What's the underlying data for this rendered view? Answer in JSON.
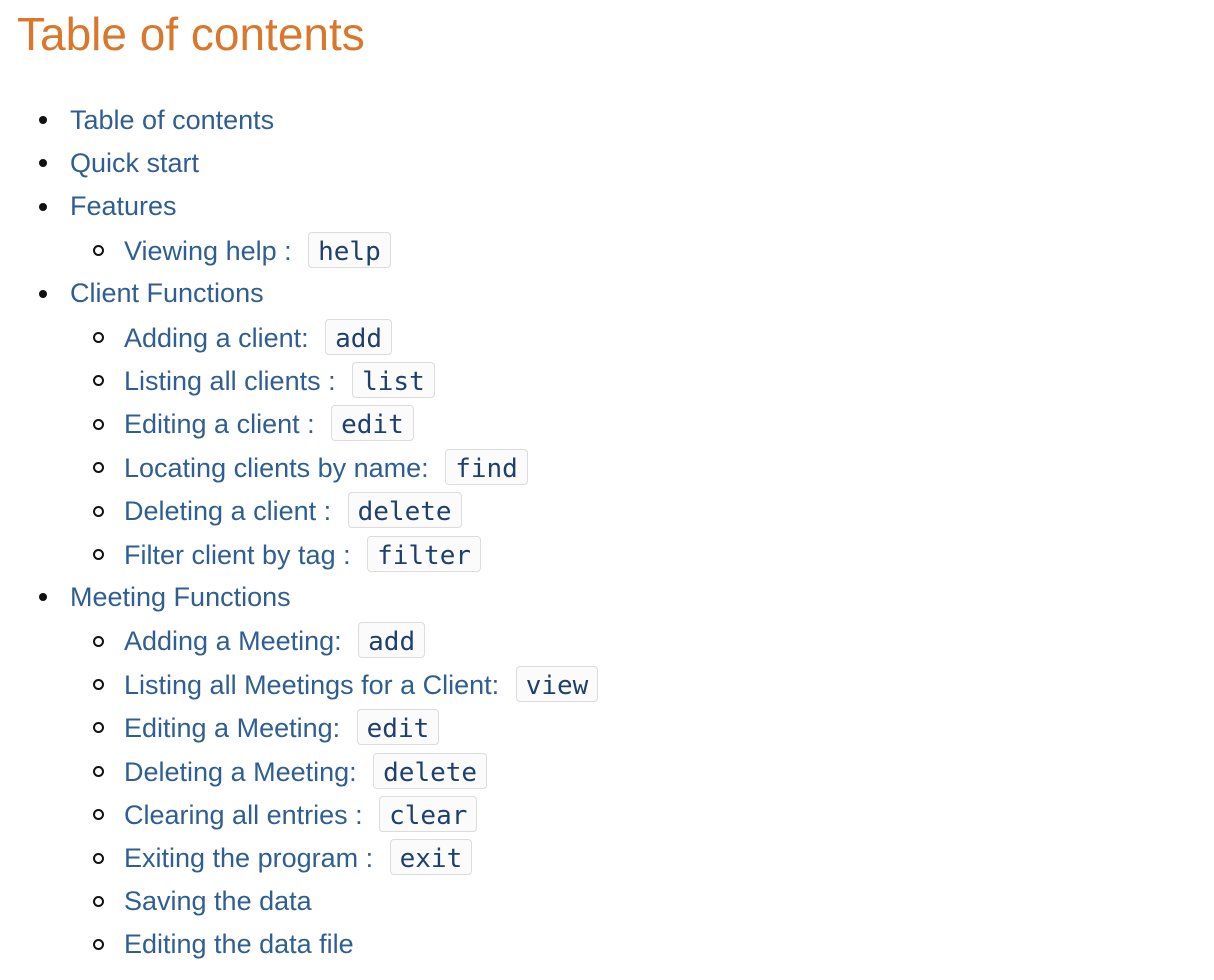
{
  "title": "Table of contents",
  "toc": {
    "items": [
      {
        "label": "Table of contents"
      },
      {
        "label": "Quick start"
      },
      {
        "label": "Features",
        "children": [
          {
            "label": "Viewing help : ",
            "code": "help"
          }
        ]
      },
      {
        "label": "Client Functions",
        "children": [
          {
            "label": "Adding a client: ",
            "code": "add"
          },
          {
            "label": "Listing all clients : ",
            "code": "list"
          },
          {
            "label": "Editing a client : ",
            "code": "edit"
          },
          {
            "label": "Locating clients by name: ",
            "code": "find"
          },
          {
            "label": "Deleting a client : ",
            "code": "delete"
          },
          {
            "label": "Filter client by tag : ",
            "code": "filter"
          }
        ]
      },
      {
        "label": "Meeting Functions",
        "children": [
          {
            "label": "Adding a Meeting: ",
            "code": "add"
          },
          {
            "label": "Listing all Meetings for a Client: ",
            "code": "view"
          },
          {
            "label": "Editing a Meeting: ",
            "code": "edit"
          },
          {
            "label": "Deleting a Meeting: ",
            "code": "delete"
          },
          {
            "label": "Clearing all entries : ",
            "code": "clear"
          },
          {
            "label": "Exiting the program : ",
            "code": "exit"
          },
          {
            "label": "Saving the data"
          },
          {
            "label": "Editing the data file"
          }
        ]
      }
    ]
  },
  "colors": {
    "title": "#d9782d",
    "link": "#2f5e93",
    "code_text": "#1f3f6e",
    "code_border": "#dcdcdc"
  }
}
